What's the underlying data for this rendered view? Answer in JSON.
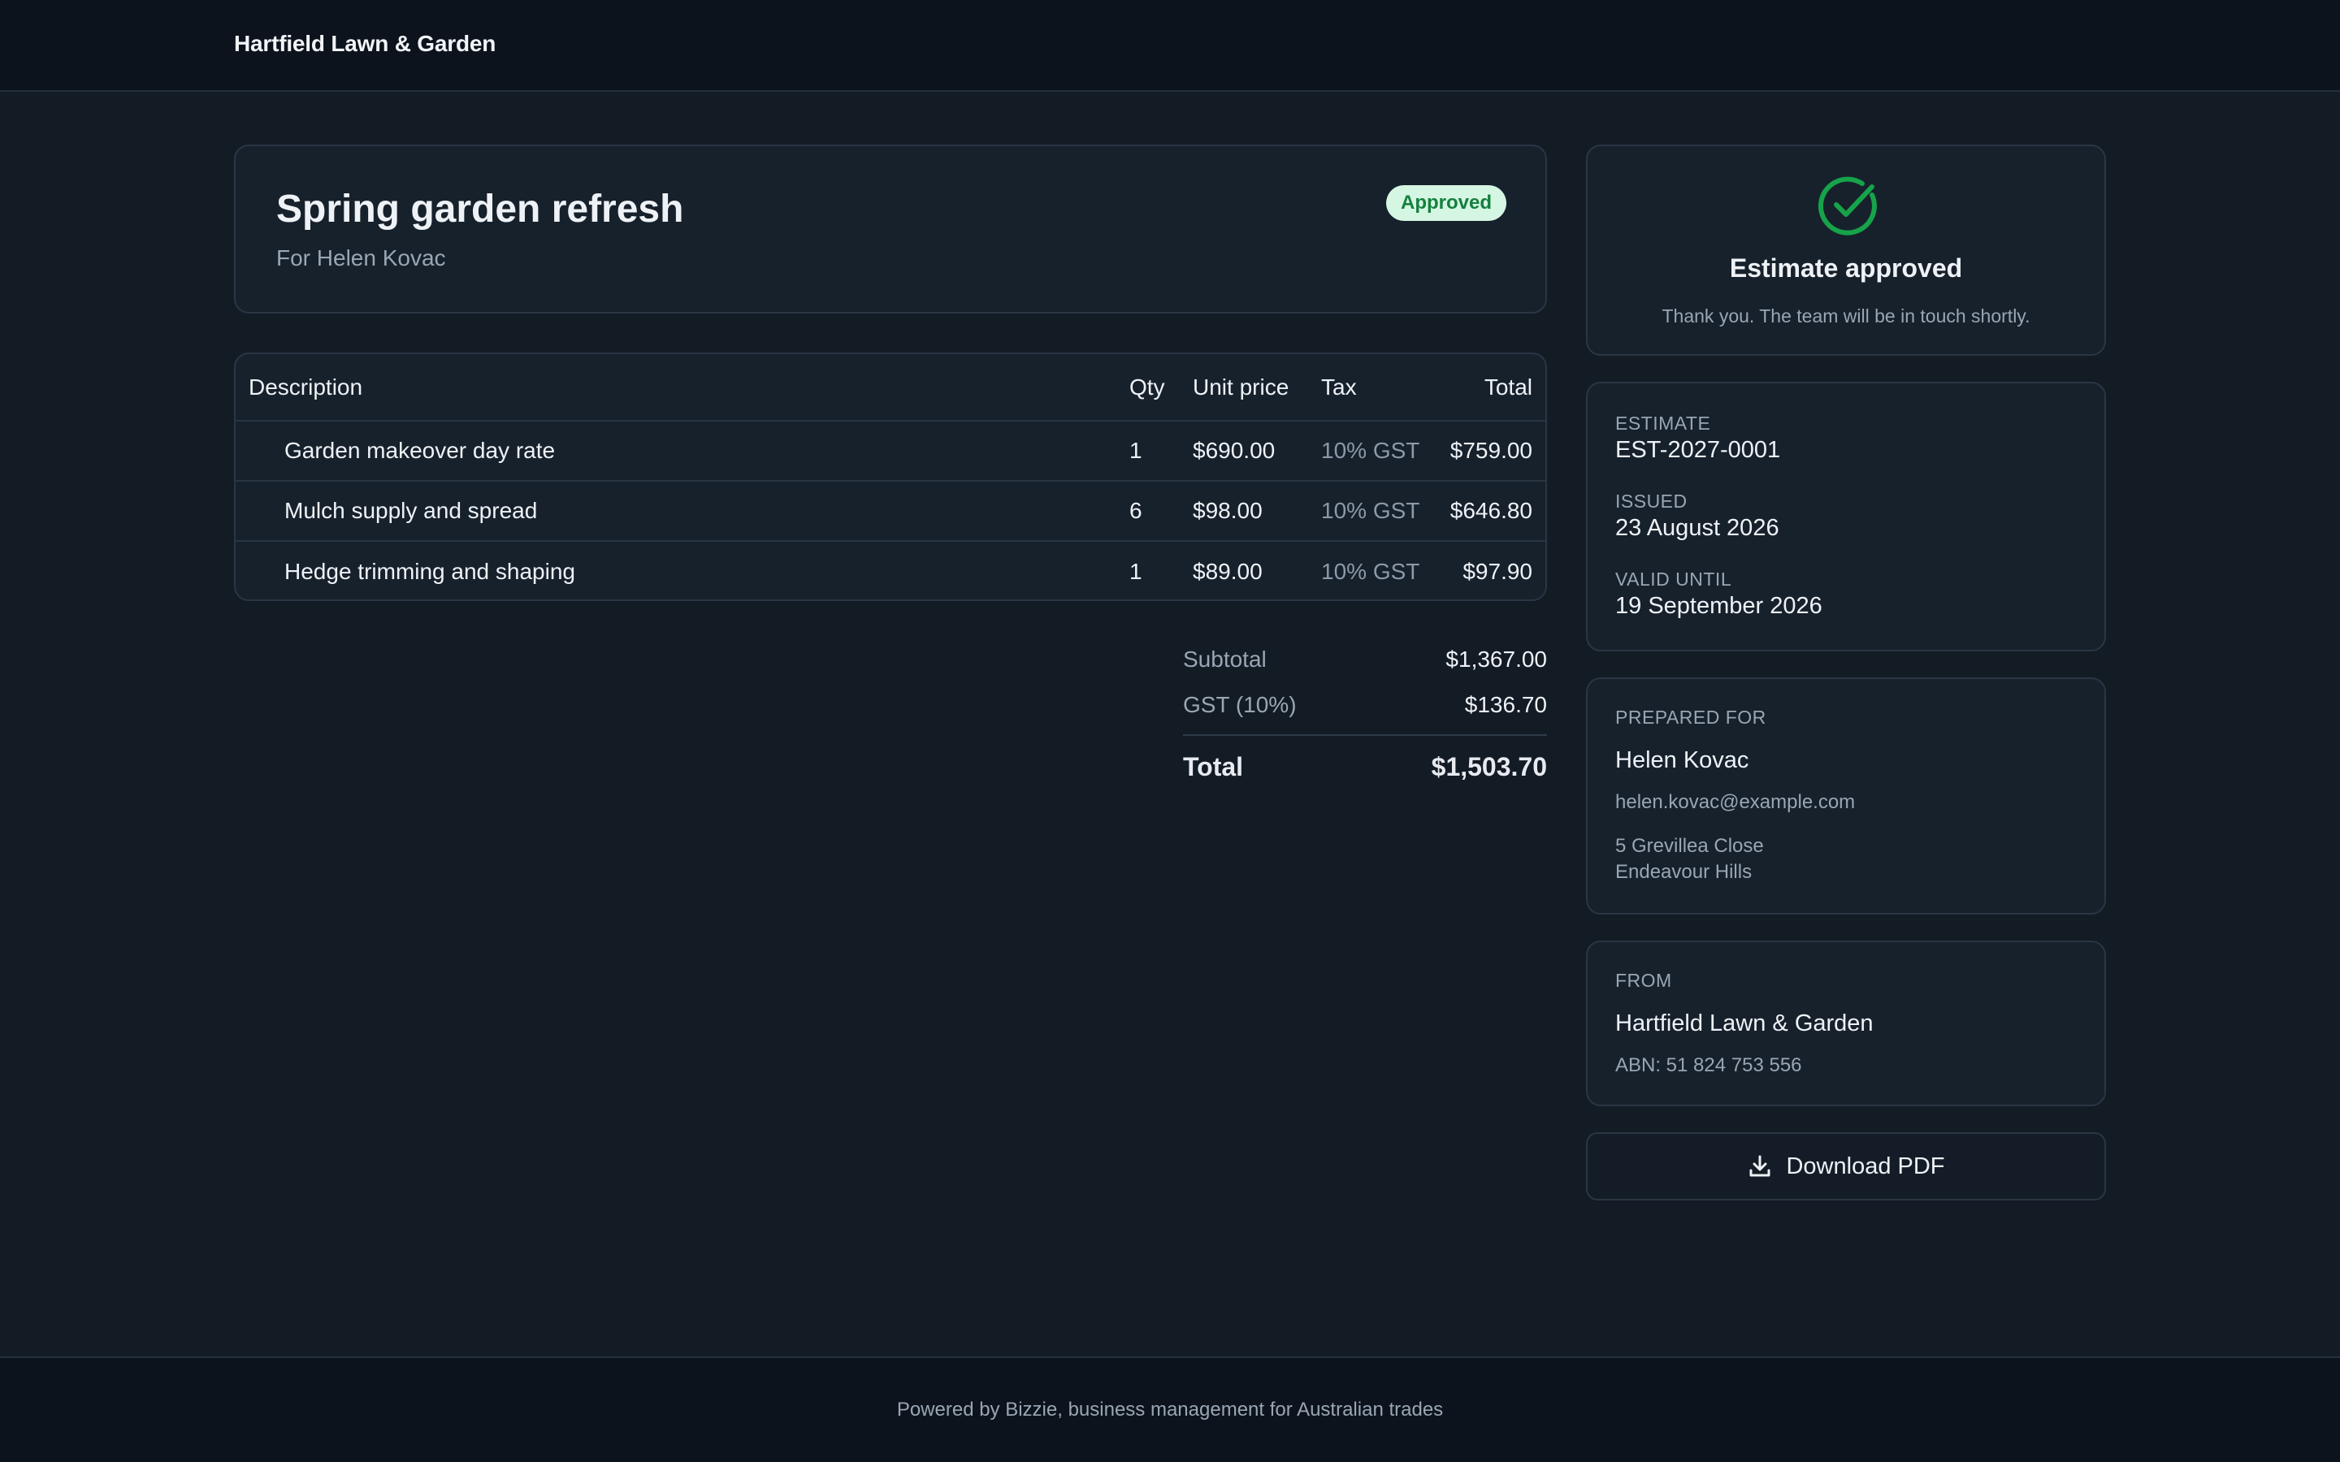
{
  "header": {
    "brand": "Hartfield Lawn & Garden"
  },
  "estimate_header": {
    "title": "Spring garden refresh",
    "for_line": "For Helen Kovac",
    "status": "Approved"
  },
  "table": {
    "columns": [
      "Description",
      "Qty",
      "Unit price",
      "Tax",
      "Total"
    ],
    "rows": [
      {
        "description": "Garden makeover day rate",
        "qty": "1",
        "unit_price": "$690.00",
        "tax": "10% GST",
        "total": "$759.00"
      },
      {
        "description": "Mulch supply and spread",
        "qty": "6",
        "unit_price": "$98.00",
        "tax": "10% GST",
        "total": "$646.80"
      },
      {
        "description": "Hedge trimming and shaping",
        "qty": "1",
        "unit_price": "$89.00",
        "tax": "10% GST",
        "total": "$97.90"
      }
    ]
  },
  "totals": {
    "subtotal_label": "Subtotal",
    "subtotal": "$1,367.00",
    "gst_label": "GST (10%)",
    "gst": "$136.70",
    "total_label": "Total",
    "total": "$1,503.70"
  },
  "approval": {
    "icon": "check-circle-icon",
    "title": "Estimate approved",
    "message": "Thank you. The team will be in touch shortly."
  },
  "meta": {
    "estimate_label": "ESTIMATE",
    "estimate_no": "EST-2027-0001",
    "issued_label": "ISSUED",
    "issued": "23 August 2026",
    "valid_label": "VALID UNTIL",
    "valid_until": "19 September 2026"
  },
  "prepared_for": {
    "label": "PREPARED FOR",
    "name": "Helen Kovac",
    "email": "helen.kovac@example.com",
    "address_line1": "5 Grevillea Close",
    "address_line2": "Endeavour Hills"
  },
  "from": {
    "label": "FROM",
    "name": "Hartfield Lawn & Garden",
    "abn": "ABN: 51 824 753 556"
  },
  "actions": {
    "download_label": "Download PDF",
    "download_icon": "download-icon"
  },
  "footer": {
    "text": "Powered by Bizzie, business management for Australian trades"
  },
  "colors": {
    "accent_green": "#16a34a",
    "badge_bg": "#d5f6e2",
    "background": "#131b25"
  }
}
